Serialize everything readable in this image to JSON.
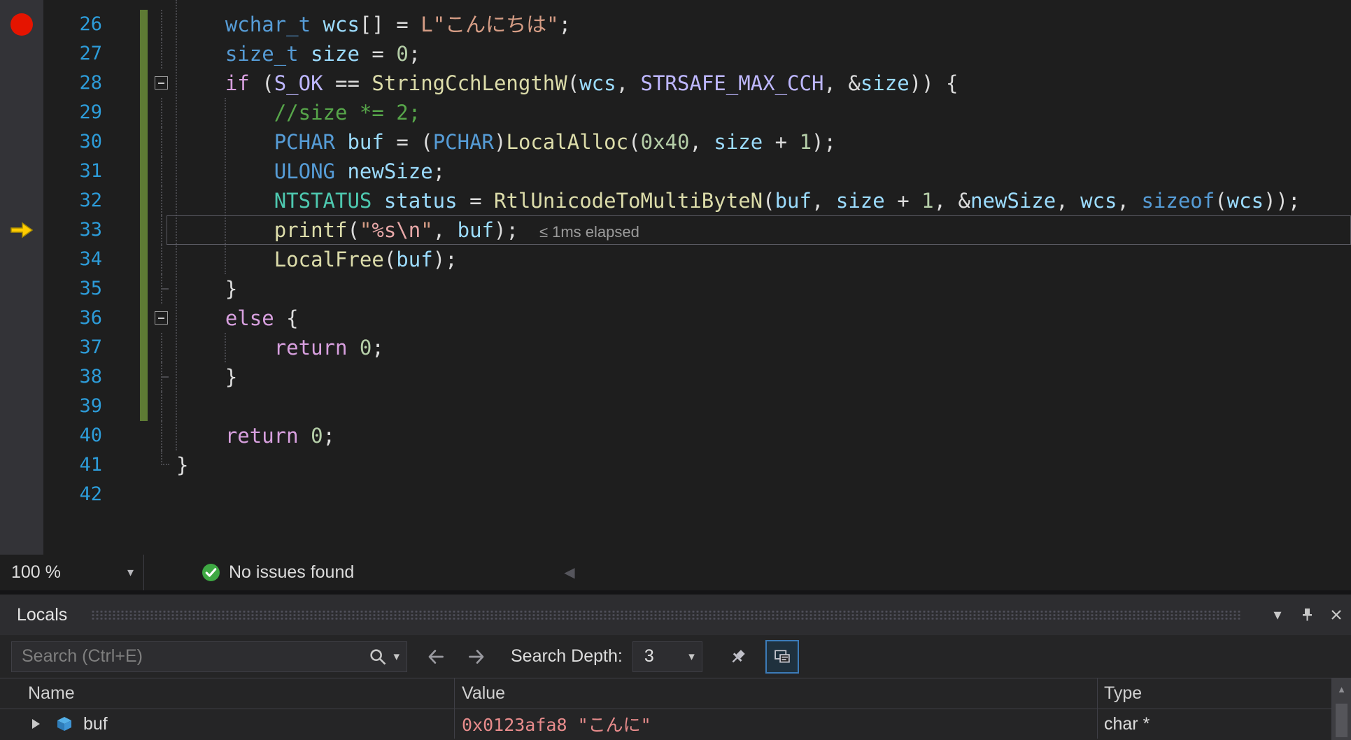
{
  "editor": {
    "breakpoint_line": 26,
    "current_line": 33,
    "perf_tip": "≤ 1ms elapsed",
    "lines": [
      {
        "n": 26,
        "fold": "line",
        "saved": true,
        "tokens": [
          {
            "t": "    ",
            "c": "p"
          },
          {
            "t": "wchar_t",
            "c": "k"
          },
          {
            "t": " ",
            "c": "p"
          },
          {
            "t": "wcs",
            "c": "v"
          },
          {
            "t": "[] = ",
            "c": "p"
          },
          {
            "t": "L\"こんにちは\"",
            "c": "s"
          },
          {
            "t": ";",
            "c": "p"
          }
        ]
      },
      {
        "n": 27,
        "fold": "line",
        "saved": true,
        "tokens": [
          {
            "t": "    ",
            "c": "p"
          },
          {
            "t": "size_t",
            "c": "k"
          },
          {
            "t": " ",
            "c": "p"
          },
          {
            "t": "size",
            "c": "v"
          },
          {
            "t": " = ",
            "c": "p"
          },
          {
            "t": "0",
            "c": "n"
          },
          {
            "t": ";",
            "c": "p"
          }
        ]
      },
      {
        "n": 28,
        "fold": "box",
        "saved": true,
        "tokens": [
          {
            "t": "    ",
            "c": "p"
          },
          {
            "t": "if",
            "c": "c"
          },
          {
            "t": " (",
            "c": "p"
          },
          {
            "t": "S_OK",
            "c": "m"
          },
          {
            "t": " == ",
            "c": "p"
          },
          {
            "t": "StringCchLengthW",
            "c": "f"
          },
          {
            "t": "(",
            "c": "p"
          },
          {
            "t": "wcs",
            "c": "v"
          },
          {
            "t": ", ",
            "c": "p"
          },
          {
            "t": "STRSAFE_MAX_CCH",
            "c": "m"
          },
          {
            "t": ", &",
            "c": "p"
          },
          {
            "t": "size",
            "c": "v"
          },
          {
            "t": ")) {",
            "c": "p"
          }
        ]
      },
      {
        "n": 29,
        "fold": "line",
        "saved": true,
        "tokens": [
          {
            "t": "        ",
            "c": "p"
          },
          {
            "t": "//size *= 2;",
            "c": "cm"
          }
        ]
      },
      {
        "n": 30,
        "fold": "line",
        "saved": true,
        "tokens": [
          {
            "t": "        ",
            "c": "p"
          },
          {
            "t": "PCHAR",
            "c": "k"
          },
          {
            "t": " ",
            "c": "p"
          },
          {
            "t": "buf",
            "c": "v"
          },
          {
            "t": " = (",
            "c": "p"
          },
          {
            "t": "PCHAR",
            "c": "k"
          },
          {
            "t": ")",
            "c": "p"
          },
          {
            "t": "LocalAlloc",
            "c": "f"
          },
          {
            "t": "(",
            "c": "p"
          },
          {
            "t": "0x40",
            "c": "n"
          },
          {
            "t": ", ",
            "c": "p"
          },
          {
            "t": "size",
            "c": "v"
          },
          {
            "t": " + ",
            "c": "p"
          },
          {
            "t": "1",
            "c": "n"
          },
          {
            "t": ");",
            "c": "p"
          }
        ]
      },
      {
        "n": 31,
        "fold": "line",
        "saved": true,
        "tokens": [
          {
            "t": "        ",
            "c": "p"
          },
          {
            "t": "ULONG",
            "c": "k"
          },
          {
            "t": " ",
            "c": "p"
          },
          {
            "t": "newSize",
            "c": "v"
          },
          {
            "t": ";",
            "c": "p"
          }
        ]
      },
      {
        "n": 32,
        "fold": "line",
        "saved": true,
        "tokens": [
          {
            "t": "        ",
            "c": "p"
          },
          {
            "t": "NTSTATUS",
            "c": "t"
          },
          {
            "t": " ",
            "c": "p"
          },
          {
            "t": "status",
            "c": "v"
          },
          {
            "t": " = ",
            "c": "p"
          },
          {
            "t": "RtlUnicodeToMultiByteN",
            "c": "f"
          },
          {
            "t": "(",
            "c": "p"
          },
          {
            "t": "buf",
            "c": "v"
          },
          {
            "t": ", ",
            "c": "p"
          },
          {
            "t": "size",
            "c": "v"
          },
          {
            "t": " + ",
            "c": "p"
          },
          {
            "t": "1",
            "c": "n"
          },
          {
            "t": ", &",
            "c": "p"
          },
          {
            "t": "newSize",
            "c": "v"
          },
          {
            "t": ", ",
            "c": "p"
          },
          {
            "t": "wcs",
            "c": "v"
          },
          {
            "t": ", ",
            "c": "p"
          },
          {
            "t": "sizeof",
            "c": "k"
          },
          {
            "t": "(",
            "c": "p"
          },
          {
            "t": "wcs",
            "c": "v"
          },
          {
            "t": "));",
            "c": "p"
          }
        ]
      },
      {
        "n": 33,
        "fold": "line",
        "saved": true,
        "tokens": [
          {
            "t": "        ",
            "c": "p"
          },
          {
            "t": "printf",
            "c": "f"
          },
          {
            "t": "(",
            "c": "p"
          },
          {
            "t": "\"",
            "c": "s"
          },
          {
            "t": "%s\\n",
            "c": "e"
          },
          {
            "t": "\"",
            "c": "s"
          },
          {
            "t": ", ",
            "c": "p"
          },
          {
            "t": "buf",
            "c": "v"
          },
          {
            "t": ");",
            "c": "p"
          }
        ]
      },
      {
        "n": 34,
        "fold": "line",
        "saved": true,
        "tokens": [
          {
            "t": "        ",
            "c": "p"
          },
          {
            "t": "LocalFree",
            "c": "f"
          },
          {
            "t": "(",
            "c": "p"
          },
          {
            "t": "buf",
            "c": "v"
          },
          {
            "t": ");",
            "c": "p"
          }
        ]
      },
      {
        "n": 35,
        "fold": "tick",
        "saved": true,
        "tokens": [
          {
            "t": "    }",
            "c": "p"
          }
        ]
      },
      {
        "n": 36,
        "fold": "box",
        "saved": true,
        "tokens": [
          {
            "t": "    ",
            "c": "p"
          },
          {
            "t": "else",
            "c": "c"
          },
          {
            "t": " {",
            "c": "p"
          }
        ]
      },
      {
        "n": 37,
        "fold": "line",
        "saved": true,
        "tokens": [
          {
            "t": "        ",
            "c": "p"
          },
          {
            "t": "return",
            "c": "c"
          },
          {
            "t": " ",
            "c": "p"
          },
          {
            "t": "0",
            "c": "n"
          },
          {
            "t": ";",
            "c": "p"
          }
        ]
      },
      {
        "n": 38,
        "fold": "tick",
        "saved": true,
        "tokens": [
          {
            "t": "    }",
            "c": "p"
          }
        ]
      },
      {
        "n": 39,
        "fold": "line",
        "saved": true,
        "tokens": []
      },
      {
        "n": 40,
        "fold": "line",
        "saved": false,
        "tokens": [
          {
            "t": "    ",
            "c": "p"
          },
          {
            "t": "return",
            "c": "c"
          },
          {
            "t": " ",
            "c": "p"
          },
          {
            "t": "0",
            "c": "n"
          },
          {
            "t": ";",
            "c": "p"
          }
        ]
      },
      {
        "n": 41,
        "fold": "end",
        "saved": false,
        "tokens": [
          {
            "t": "}",
            "c": "p"
          }
        ]
      },
      {
        "n": 42,
        "fold": "none",
        "saved": false,
        "tokens": []
      }
    ]
  },
  "statusbar": {
    "zoom": "100 %",
    "message": "No issues found"
  },
  "locals": {
    "title": "Locals",
    "search_placeholder": "Search (Ctrl+E)",
    "depth_label": "Search Depth:",
    "depth_value": "3",
    "columns": [
      "Name",
      "Value",
      "Type"
    ],
    "rows": [
      {
        "name": "buf",
        "value": "0x0123afa8 \"こんに\"",
        "type": "char *",
        "changed": true,
        "expandable": true
      }
    ]
  },
  "colors": {
    "editor_background": "#1E1E1E",
    "panel_background": "#252526",
    "accent": "#007ACC",
    "breakpoint_red": "#E51400",
    "current_statement_yellow": "#FFCC00",
    "saved_change_track": "#5E7B34",
    "changed_value_red": "#E88C8C",
    "no_issues_green": "#3EA843",
    "line_number_blue": "#2D9CD9",
    "keyword": "#569CD6",
    "control_keyword": "#D8A0DF",
    "type_name": "#4EC9B0",
    "variable": "#9CDCFE",
    "function_name": "#DCDCAA",
    "string": "#D69D85",
    "number": "#B5CEA8",
    "macro": "#BEB7FF",
    "comment": "#57A64A"
  }
}
